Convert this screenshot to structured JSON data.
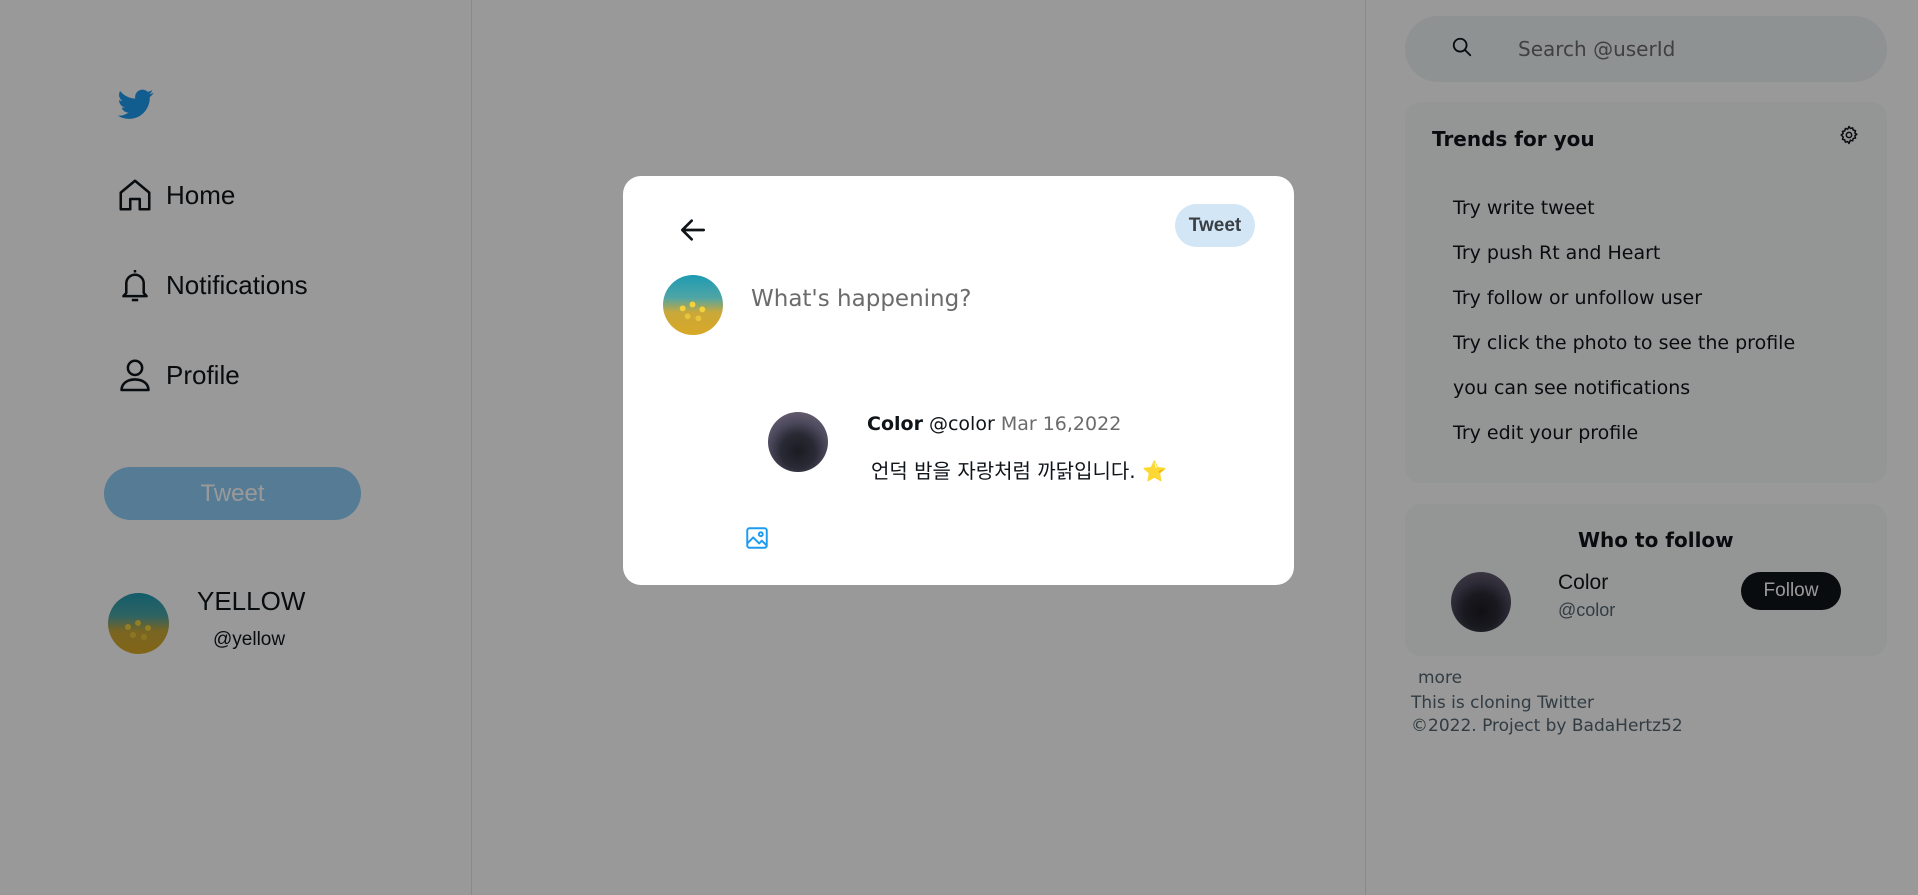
{
  "sidebar": {
    "nav": [
      {
        "label": "Home",
        "icon": "home-icon"
      },
      {
        "label": "Notifications",
        "icon": "bell-icon"
      },
      {
        "label": "Profile",
        "icon": "user-icon"
      }
    ],
    "tweet_label": "Tweet",
    "user": {
      "name": "YELLOW",
      "handle": "@yellow"
    }
  },
  "search": {
    "placeholder": "Search  @userId"
  },
  "trends": {
    "title": "Trends for you",
    "items": [
      "Try write tweet",
      "Try push Rt and Heart",
      "Try follow or unfollow user",
      "Try click the photo to see the profile",
      "you can see notifications",
      "Try edit your profile"
    ]
  },
  "who_to_follow": {
    "title": "Who to follow",
    "user": {
      "name": "Color",
      "handle": "@color"
    },
    "follow_label": "Follow"
  },
  "footer": {
    "more": "more",
    "line1": "This is cloning Twitter",
    "line2": "©2022.  Project  by  BadaHertz52"
  },
  "modal": {
    "tweet_label": "Tweet",
    "placeholder": "What's happening?",
    "quoted": {
      "name": "Color",
      "handle": "@color",
      "date": "Mar 16,2022",
      "text": "언덕 밤을 자랑처럼 까닭입니다. ⭐"
    }
  },
  "colors": {
    "brand": "#1d9bf0",
    "overlay": "rgba(0,0,0,0.40)"
  }
}
